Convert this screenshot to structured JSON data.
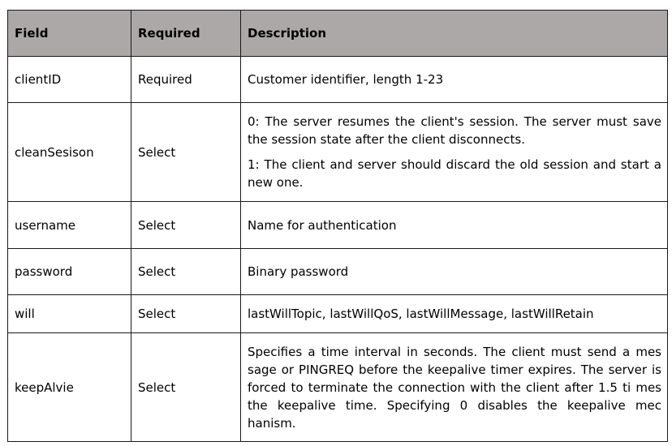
{
  "table": {
    "headers": {
      "field": "Field",
      "required": "Required",
      "description": "Description"
    },
    "rows": [
      {
        "field": "clientID",
        "required": "Required",
        "description": [
          "Customer identifier, length 1-23"
        ]
      },
      {
        "field": "cleanSesison",
        "required": "Select",
        "description": [
          "0: The server resumes the client's session. The server must save the session state after the client disconnects.",
          "1: The client and server should discard the old session and start a new one."
        ]
      },
      {
        "field": "username",
        "required": "Select",
        "description": [
          "Name for authentication"
        ]
      },
      {
        "field": "password",
        "required": "Select",
        "description": [
          "Binary password"
        ]
      },
      {
        "field": "will",
        "required": "Select",
        "description": [
          "lastWillTopic, lastWillQoS, lastWillMessage, lastWillRetain"
        ]
      },
      {
        "field": "keepAlvie",
        "required": "Select",
        "description": [
          "Specifies a time interval in seconds. The client must send a mes sage or PINGREQ before the keepalive timer expires. The server is forced to terminate the connection with the client after 1.5 ti mes the keepalive time. Specifying 0 disables the keepalive mec hanism."
        ]
      }
    ]
  }
}
